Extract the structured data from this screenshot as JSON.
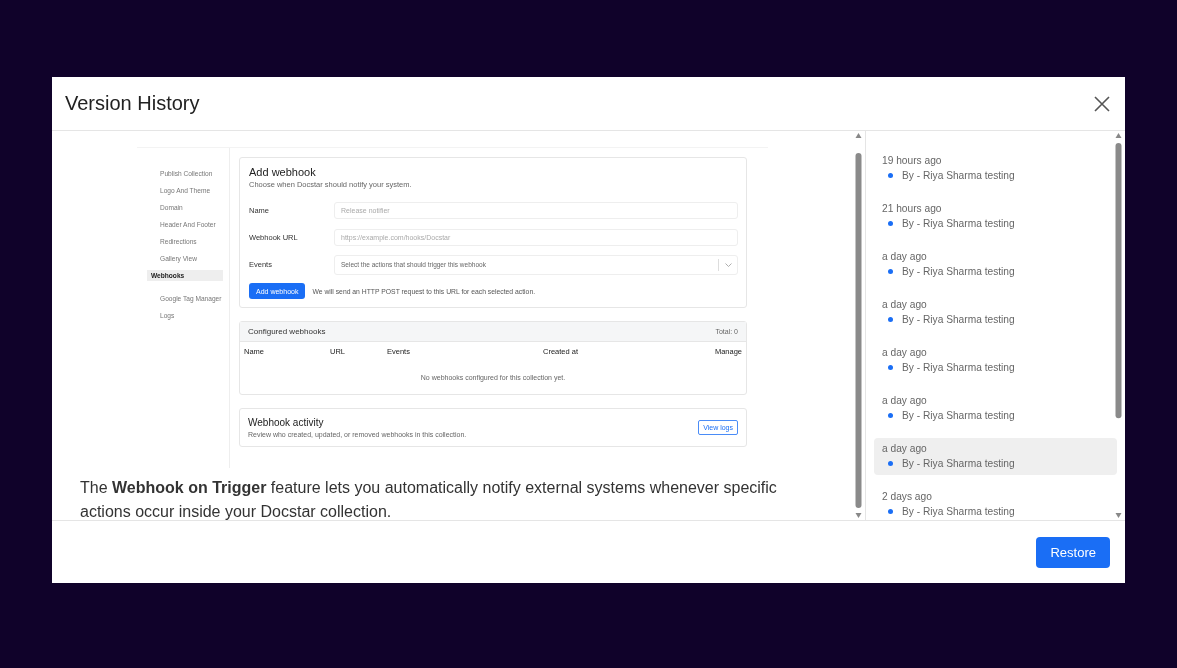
{
  "dialog": {
    "title": "Version History"
  },
  "preview": {
    "sidebar": [
      {
        "label": "Publish Collection",
        "selected": false
      },
      {
        "label": "Logo And Theme",
        "selected": false
      },
      {
        "label": "Domain",
        "selected": false
      },
      {
        "label": "Header And Footer",
        "selected": false
      },
      {
        "label": "Redirections",
        "selected": false
      },
      {
        "label": "Gallery View",
        "selected": false
      },
      {
        "label": "Webhooks",
        "selected": true
      },
      {
        "label": "Google Tag Manager",
        "selected": false
      },
      {
        "label": "Logs",
        "selected": false
      }
    ],
    "add_webhook": {
      "title": "Add webhook",
      "subtitle": "Choose when Docstar should notify your system.",
      "fields": [
        {
          "label": "Name",
          "placeholder": "Release notifier",
          "kind": "text"
        },
        {
          "label": "Webhook URL",
          "placeholder": "https://example.com/hooks/Docstar",
          "kind": "text"
        },
        {
          "label": "Events",
          "placeholder": "Select the actions that should trigger this webhook",
          "kind": "select"
        }
      ],
      "button": "Add webhook",
      "note": "We will send an HTTP POST request to this URL for each selected action."
    },
    "configured": {
      "title": "Configured webhooks",
      "total": "Total: 0",
      "columns": [
        "Name",
        "URL",
        "Events",
        "Created at",
        "Manage"
      ],
      "empty": "No webhooks configured for this collection yet."
    },
    "activity": {
      "title": "Webhook activity",
      "description": "Review who created, updated, or removed webhooks in this collection.",
      "button": "View logs"
    }
  },
  "description": "The **Webhook on Trigger** feature lets you automatically notify external systems whenever specific actions occur inside your Docstar collection.",
  "versions": [
    {
      "time": "19 hours ago",
      "author": "By - Riya Sharma testing",
      "selected": false
    },
    {
      "time": "21 hours ago",
      "author": "By - Riya Sharma testing",
      "selected": false
    },
    {
      "time": "a day ago",
      "author": "By - Riya Sharma testing",
      "selected": false
    },
    {
      "time": "a day ago",
      "author": "By - Riya Sharma testing",
      "selected": false
    },
    {
      "time": "a day ago",
      "author": "By - Riya Sharma testing",
      "selected": false
    },
    {
      "time": "a day ago",
      "author": "By - Riya Sharma testing",
      "selected": false
    },
    {
      "time": "a day ago",
      "author": "By - Riya Sharma testing",
      "selected": true
    },
    {
      "time": "2 days ago",
      "author": "By - Riya Sharma testing",
      "selected": false
    }
  ],
  "footer": {
    "button": "Restore"
  }
}
